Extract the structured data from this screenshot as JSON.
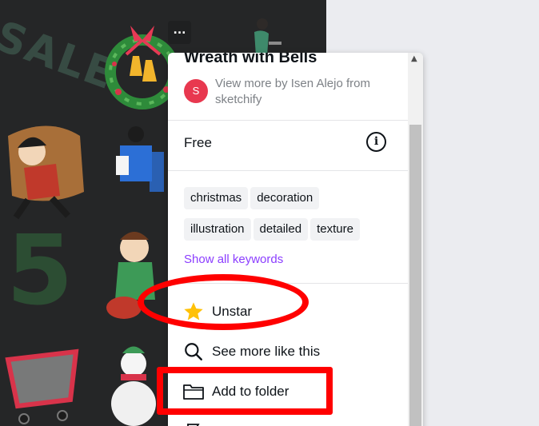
{
  "more_button": {
    "label": "..."
  },
  "background_art": {
    "sale_text": "SALE",
    "five_text": "5"
  },
  "element": {
    "title": "Wreath with Bells",
    "author_initial": "S",
    "author_line": "View more by Isen Alejo from sketchify",
    "price": "Free",
    "info_icon": "info-icon",
    "tags": [
      "christmas",
      "decoration",
      "illustration",
      "detailed",
      "texture"
    ],
    "show_all_keywords": "Show all keywords"
  },
  "menu": {
    "unstar": {
      "label": "Unstar",
      "icon": "star-icon"
    },
    "see_more": {
      "label": "See more like this",
      "icon": "search-icon"
    },
    "add_folder": {
      "label": "Add to folder",
      "icon": "folder-icon"
    }
  },
  "colors": {
    "accent": "#8b3dff",
    "avatar": "#e8384f",
    "star": "#ffc107",
    "annotation": "#ff0000",
    "panel": "#252627"
  }
}
